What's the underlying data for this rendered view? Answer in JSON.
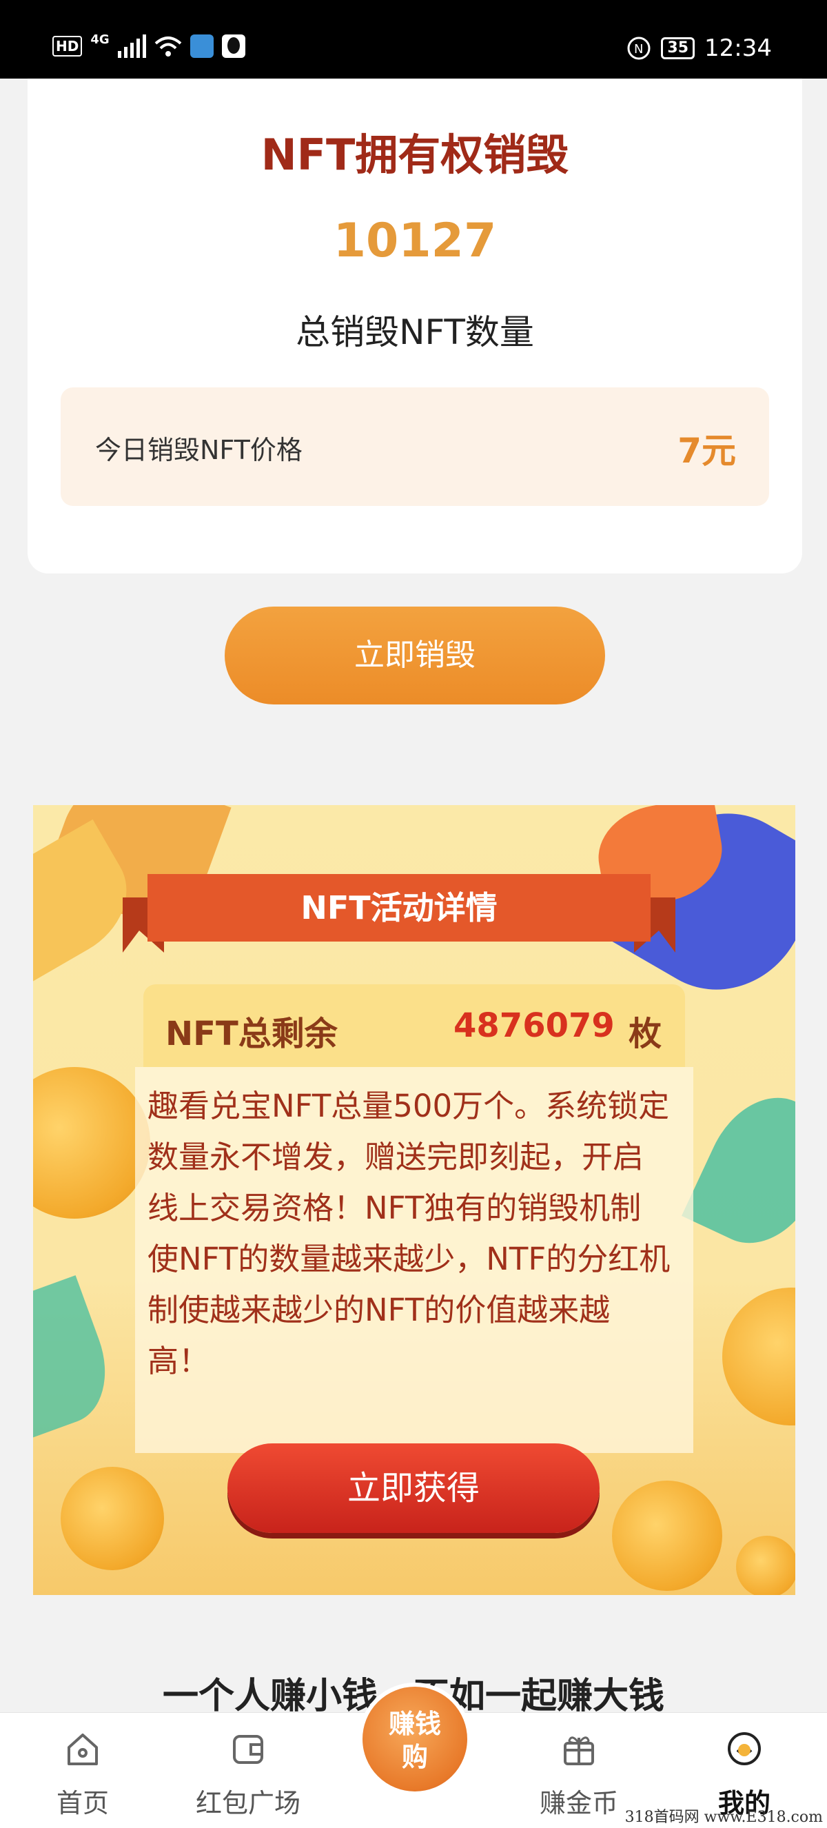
{
  "status_bar": {
    "hd": "HD",
    "network": "4G",
    "battery": "35",
    "time": "12:34"
  },
  "summary_card": {
    "title": "NFT拥有权销毁",
    "total_destroyed": "10127",
    "total_label": "总销毁NFT数量",
    "price_label": "今日销毁NFT价格",
    "price_value": "7元"
  },
  "destroy_button": "立即销毁",
  "activity": {
    "banner_title": "NFT活动详情",
    "remaining_label": "NFT总剩余",
    "remaining_value": "4876079",
    "remaining_unit": "枚",
    "description": "趣看兑宝NFT总量500万个。系统锁定数量永不增发，赠送完即刻起，开启线上交易资格！NFT独有的销毁机制使NFT的数量越来越少，NTF的分红机制使越来越少的NFT的价值越来越高！",
    "get_button": "立即获得"
  },
  "slogan": "一个人赚小钱，不如一起赚大钱",
  "bottom_nav": {
    "home": "首页",
    "red_packet": "红包广场",
    "center_line1": "赚钱",
    "center_line2": "购",
    "earn_coins": "赚金币",
    "mine": "我的"
  },
  "watermark": "318首码网 www.E318.com"
}
